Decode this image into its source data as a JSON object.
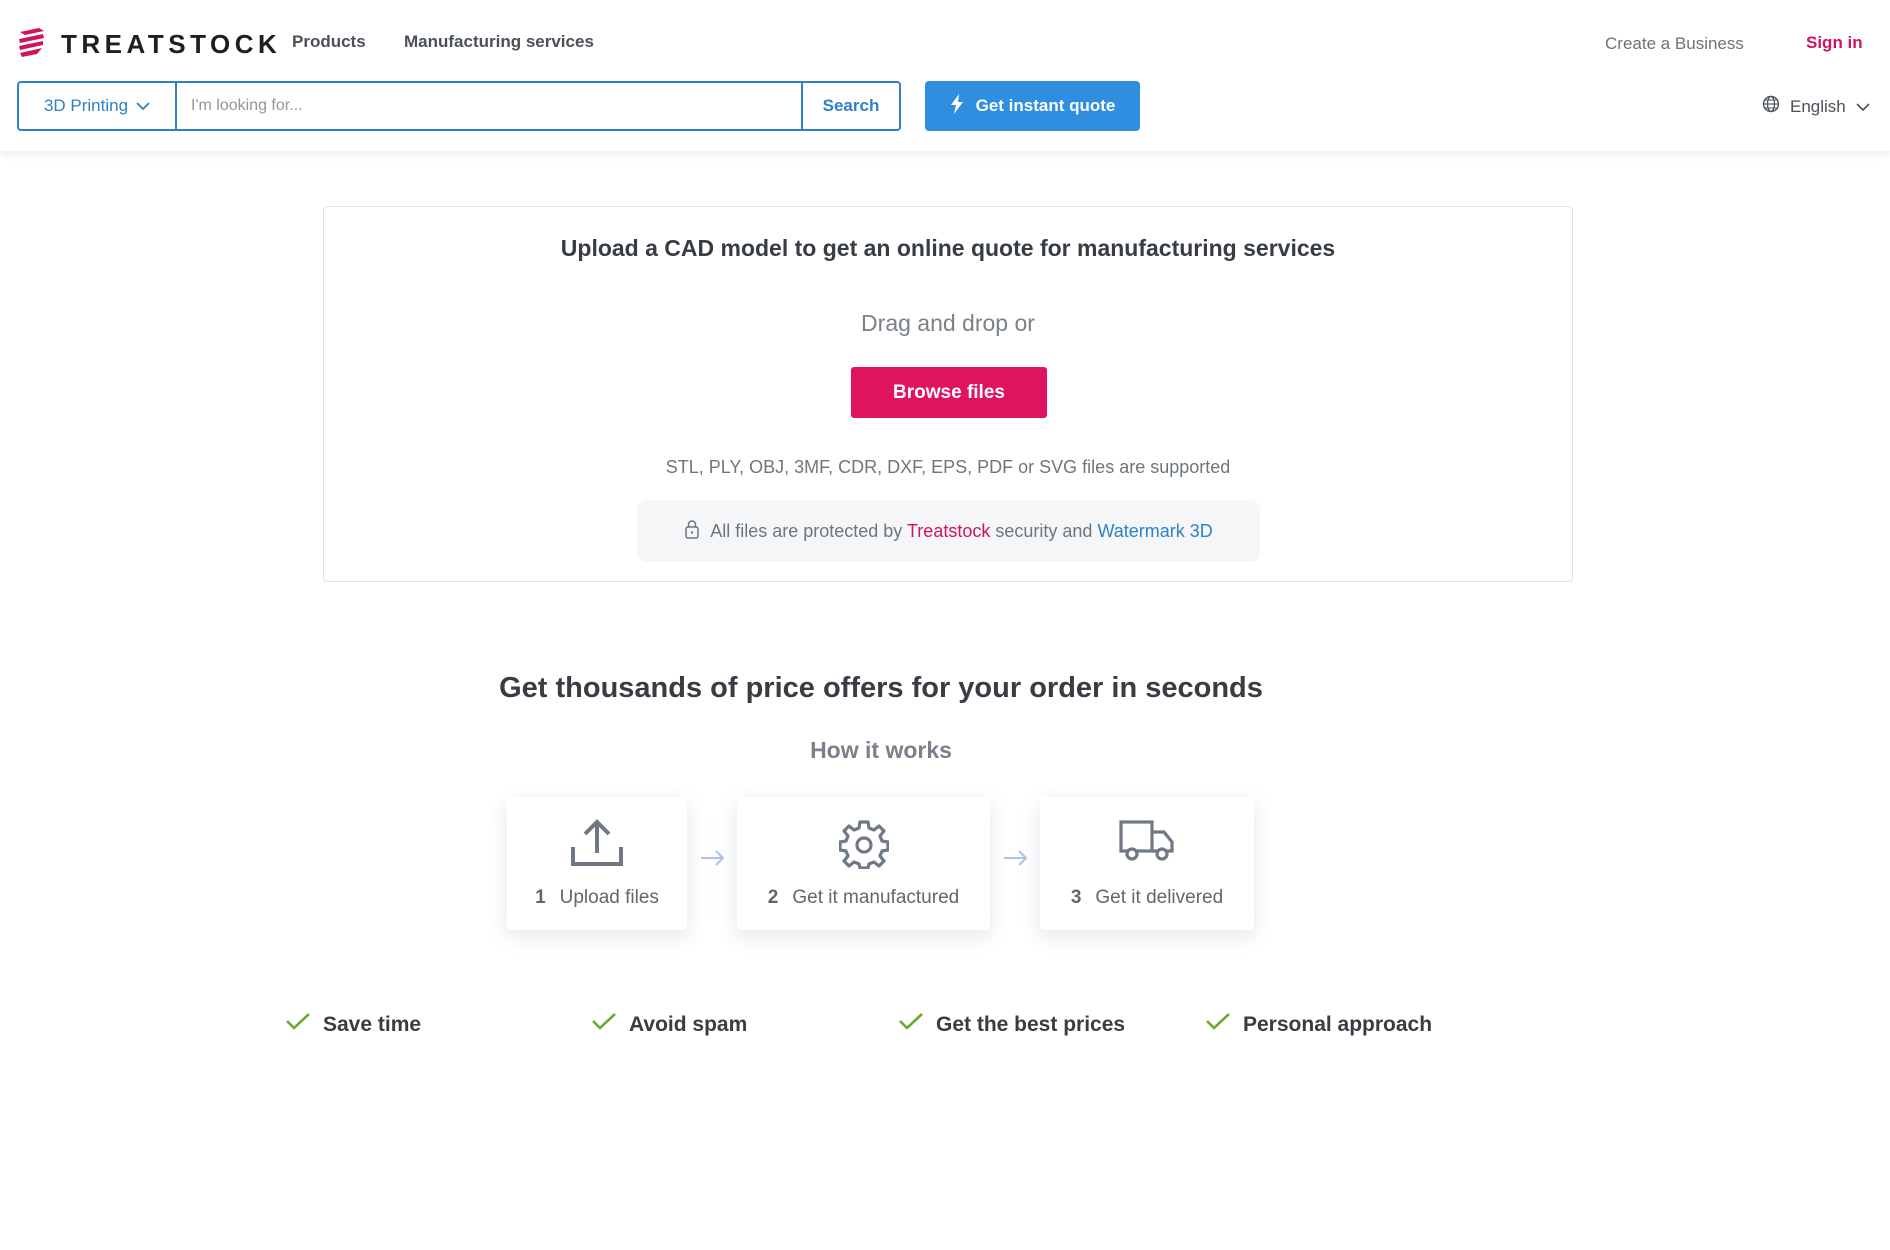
{
  "header": {
    "logo_text": "TREATSTOCK",
    "nav": {
      "products": "Products",
      "manufacturing": "Manufacturing services"
    },
    "create_business": "Create a Business",
    "sign_in": "Sign in",
    "search": {
      "category": "3D Printing",
      "placeholder": "I'm looking for...",
      "button": "Search"
    },
    "quote_button": "Get instant quote",
    "language": "English"
  },
  "upload": {
    "title": "Upload a CAD model to get an online quote for manufacturing services",
    "drag_text": "Drag and drop or",
    "browse_button": "Browse files",
    "formats": "STL, PLY, OBJ, 3MF, CDR, DXF, EPS, PDF or SVG files are supported",
    "protection": {
      "prefix": "All files are protected by",
      "brand": "Treatstock",
      "middle": "security and",
      "watermark": "Watermark 3D"
    }
  },
  "how": {
    "headline": "Get thousands of price offers for your order in seconds",
    "subtitle": "How it works",
    "steps": [
      {
        "num": "1",
        "label": "Upload files",
        "icon": "upload-icon"
      },
      {
        "num": "2",
        "label": "Get it manufactured",
        "icon": "gear-icon"
      },
      {
        "num": "3",
        "label": "Get it delivered",
        "icon": "truck-icon"
      }
    ]
  },
  "benefits": [
    "Save time",
    "Avoid spam",
    "Get the best prices",
    "Personal approach"
  ],
  "colors": {
    "brand_pink": "#e0145e",
    "brand_blue": "#2f80c8",
    "quote_blue": "#2f8ee0",
    "check_green": "#6aa832"
  }
}
